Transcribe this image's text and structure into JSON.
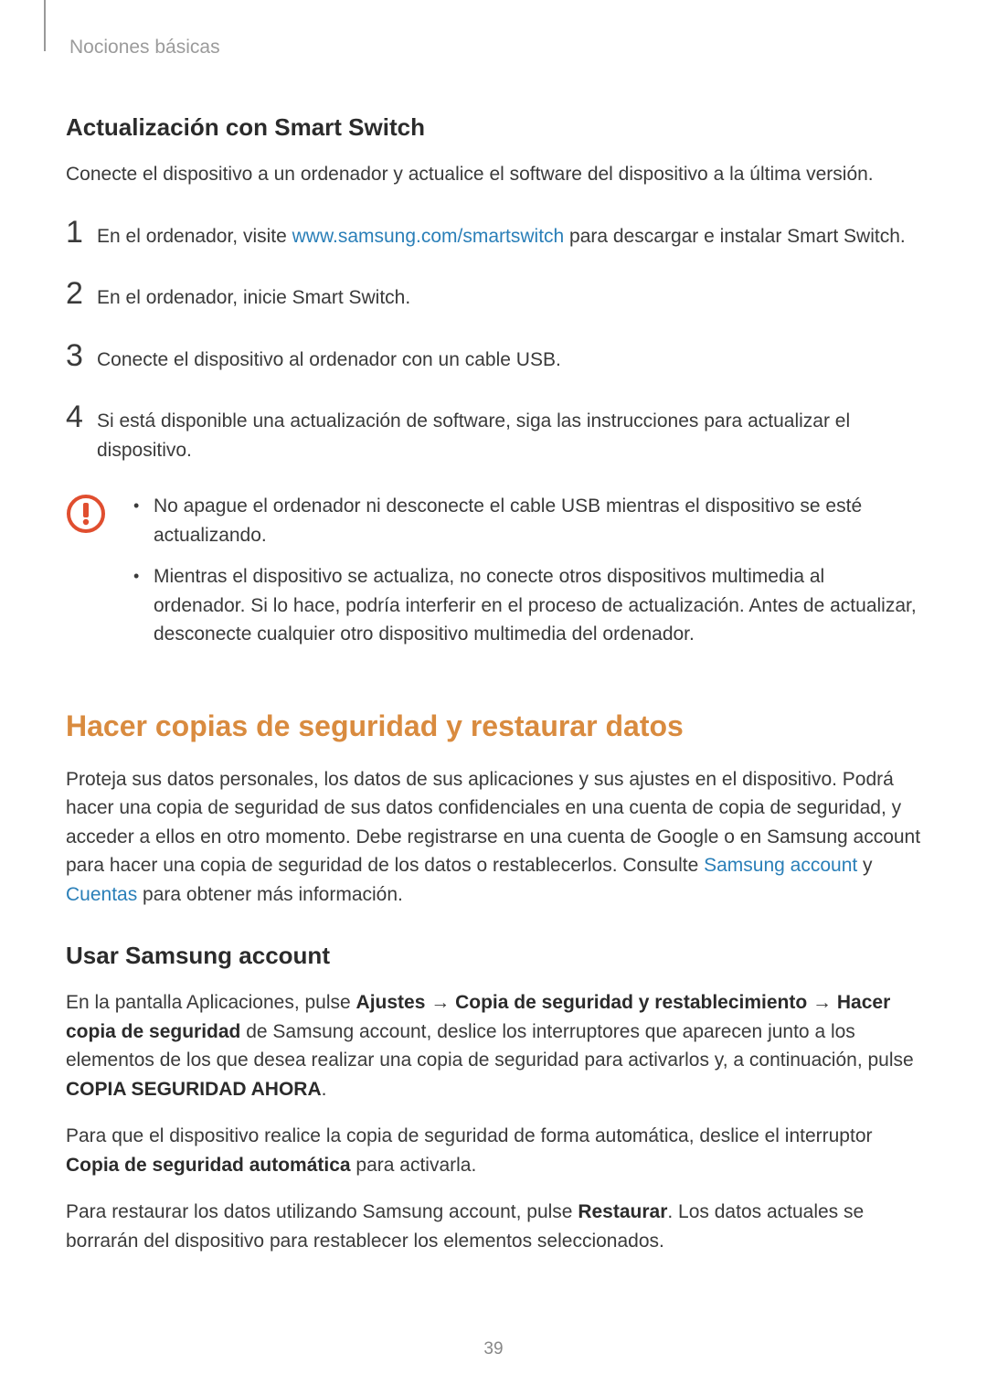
{
  "breadcrumb": "Nociones básicas",
  "section1": {
    "heading": "Actualización con Smart Switch",
    "intro": "Conecte el dispositivo a un ordenador y actualice el software del dispositivo a la última versión.",
    "steps": [
      {
        "num": "1",
        "before": "En el ordenador, visite ",
        "link": "www.samsung.com/smartswitch",
        "after": " para descargar e instalar Smart Switch."
      },
      {
        "num": "2",
        "text": "En el ordenador, inicie Smart Switch."
      },
      {
        "num": "3",
        "text": "Conecte el dispositivo al ordenador con un cable USB."
      },
      {
        "num": "4",
        "text": "Si está disponible una actualización de software, siga las instrucciones para actualizar el dispositivo."
      }
    ],
    "warnings": [
      "No apague el ordenador ni desconecte el cable USB mientras el dispositivo se esté actualizando.",
      "Mientras el dispositivo se actualiza, no conecte otros dispositivos multimedia al ordenador. Si lo hace, podría interferir en el proceso de actualización. Antes de actualizar, desconecte cualquier otro dispositivo multimedia del ordenador."
    ]
  },
  "section2": {
    "heading": "Hacer copias de seguridad y restaurar datos",
    "intro_before": "Proteja sus datos personales, los datos de sus aplicaciones y sus ajustes en el dispositivo. Podrá hacer una copia de seguridad de sus datos confidenciales en una cuenta de copia de seguridad, y acceder a ellos en otro momento. Debe registrarse en una cuenta de Google o en Samsung account para hacer una copia de seguridad de los datos o restablecerlos. Consulte ",
    "link1": "Samsung account",
    "mid": " y ",
    "link2": "Cuentas",
    "intro_after": " para obtener más información."
  },
  "section3": {
    "heading": "Usar Samsung account",
    "p1_a": "En la pantalla Aplicaciones, pulse ",
    "p1_b1": "Ajustes",
    "p1_arrow1": " → ",
    "p1_b2": "Copia de seguridad y restablecimiento",
    "p1_arrow2": " → ",
    "p1_b3": "Hacer copia de seguridad",
    "p1_c": " de Samsung account, deslice los interruptores que aparecen junto a los elementos de los que desea realizar una copia de seguridad para activarlos y, a continuación, pulse ",
    "p1_b4": "COPIA SEGURIDAD AHORA",
    "p1_d": ".",
    "p2_a": "Para que el dispositivo realice la copia de seguridad de forma automática, deslice el interruptor ",
    "p2_b": "Copia de seguridad automática",
    "p2_c": " para activarla.",
    "p3_a": "Para restaurar los datos utilizando Samsung account, pulse ",
    "p3_b": "Restaurar",
    "p3_c": ". Los datos actuales se borrarán del dispositivo para restablecer los elementos seleccionados."
  },
  "page_number": "39"
}
